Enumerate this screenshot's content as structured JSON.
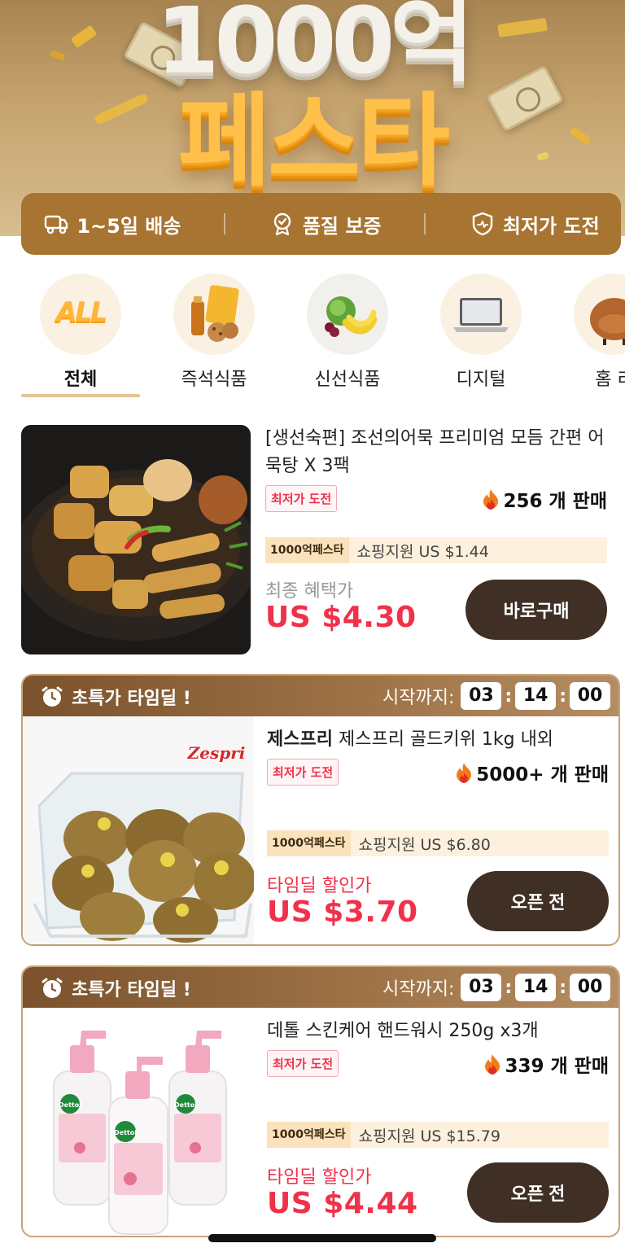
{
  "hero": {
    "line1": "1000억",
    "line2": "페스타"
  },
  "benefits": [
    {
      "icon": "delivery-icon",
      "label": "1~5일 배송"
    },
    {
      "icon": "quality-badge-icon",
      "label": "품질 보증"
    },
    {
      "icon": "shield-price-icon",
      "label": "최저가 도전"
    }
  ],
  "categories": [
    {
      "label": "전체",
      "active": true
    },
    {
      "label": "즉석식품"
    },
    {
      "label": "신선식품"
    },
    {
      "label": "디지털"
    },
    {
      "label": "홈 리"
    }
  ],
  "all_icon_text": "ALL",
  "products": [
    {
      "name": "[생선숙편] 조선의어묵 프리미엄 모듬 간편 어묵탕 X 3팩",
      "badge": "최저가 도전",
      "sold": "256 개 판매",
      "fiesta_tag": "1000억페스타",
      "support": "쇼핑지원 US $1.44",
      "price_label": "최종 혜택가",
      "price": "US $4.30",
      "button": "바로구매"
    },
    {
      "deal_title": "초특가 타임딜 !",
      "countdown_label": "시작까지:",
      "countdown": [
        "03",
        "14",
        "00"
      ],
      "brand": "제스프리",
      "name": "제스프리 골드키위 1kg 내외",
      "brand_logo": "Zespri",
      "badge": "최저가 도전",
      "sold": "5000+ 개 판매",
      "fiesta_tag": "1000억페스타",
      "support": "쇼핑지원 US $6.80",
      "price_label": "타임딜 할인가",
      "price": "US $3.70",
      "button": "오픈 전"
    },
    {
      "deal_title": "초특가 타임딜 !",
      "countdown_label": "시작까지:",
      "countdown": [
        "03",
        "14",
        "00"
      ],
      "name": "데톨 스킨케어 핸드워시 250g x3개",
      "bottle_brand": "Dettol",
      "badge": "최저가 도전",
      "sold": "339 개 판매",
      "fiesta_tag": "1000억페스타",
      "support": "쇼핑지원 US $15.79",
      "price_label": "타임딜 할인가",
      "price": "US $4.44",
      "button": "오픈 전"
    }
  ],
  "colors": {
    "benefit_bar": "#a77431",
    "price_red": "#f0314a",
    "button_dark": "#3f2f24",
    "deal_border": "#c9a277"
  }
}
